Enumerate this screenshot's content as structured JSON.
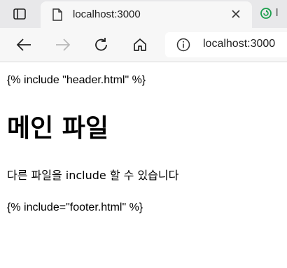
{
  "browser": {
    "tabs": [
      {
        "title": "localhost:3000",
        "active": true
      },
      {
        "title": "l",
        "active": false
      }
    ],
    "address_bar": {
      "url": "localhost:3000"
    }
  },
  "page": {
    "header_include": "{% include \"header.html\" %}",
    "heading": "메인 파일",
    "paragraph": "다른 파일을 include 할 수 있습니다",
    "footer_include": "{% include=\"footer.html\" %}"
  }
}
